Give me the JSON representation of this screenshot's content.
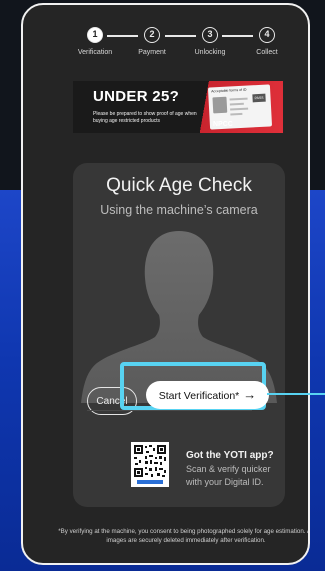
{
  "stepper": {
    "steps": [
      {
        "number": "1",
        "label": "Verification",
        "active": true
      },
      {
        "number": "2",
        "label": "Payment",
        "active": false
      },
      {
        "number": "3",
        "label": "Unlocking",
        "active": false
      },
      {
        "number": "4",
        "label": "Collect",
        "active": false
      }
    ]
  },
  "banner": {
    "title": "UNDER 25?",
    "subtitle": "Please be prepared to show proof of age when buying age restricted products",
    "card_caption": "Acceptable forms of ID",
    "card_chip": "PASS",
    "brand": "NPCC"
  },
  "card": {
    "title": "Quick Age Check",
    "subtitle": "Using the machine’s camera",
    "cancel_label": "Cancel",
    "start_label": "Start Verification*",
    "start_arrow": "→",
    "yoti_title": "Got the YOTI app?",
    "yoti_line1": "Scan & verify quicker",
    "yoti_line2": "with your Digital ID."
  },
  "disclaimer": "*By verifying at the machine, you consent to being photographed solely for age estimation. All images are securely deleted immediately after verification.",
  "colors": {
    "highlight": "#58d3f2",
    "banner_red": "#e0303a",
    "device_bg": "#252525"
  }
}
